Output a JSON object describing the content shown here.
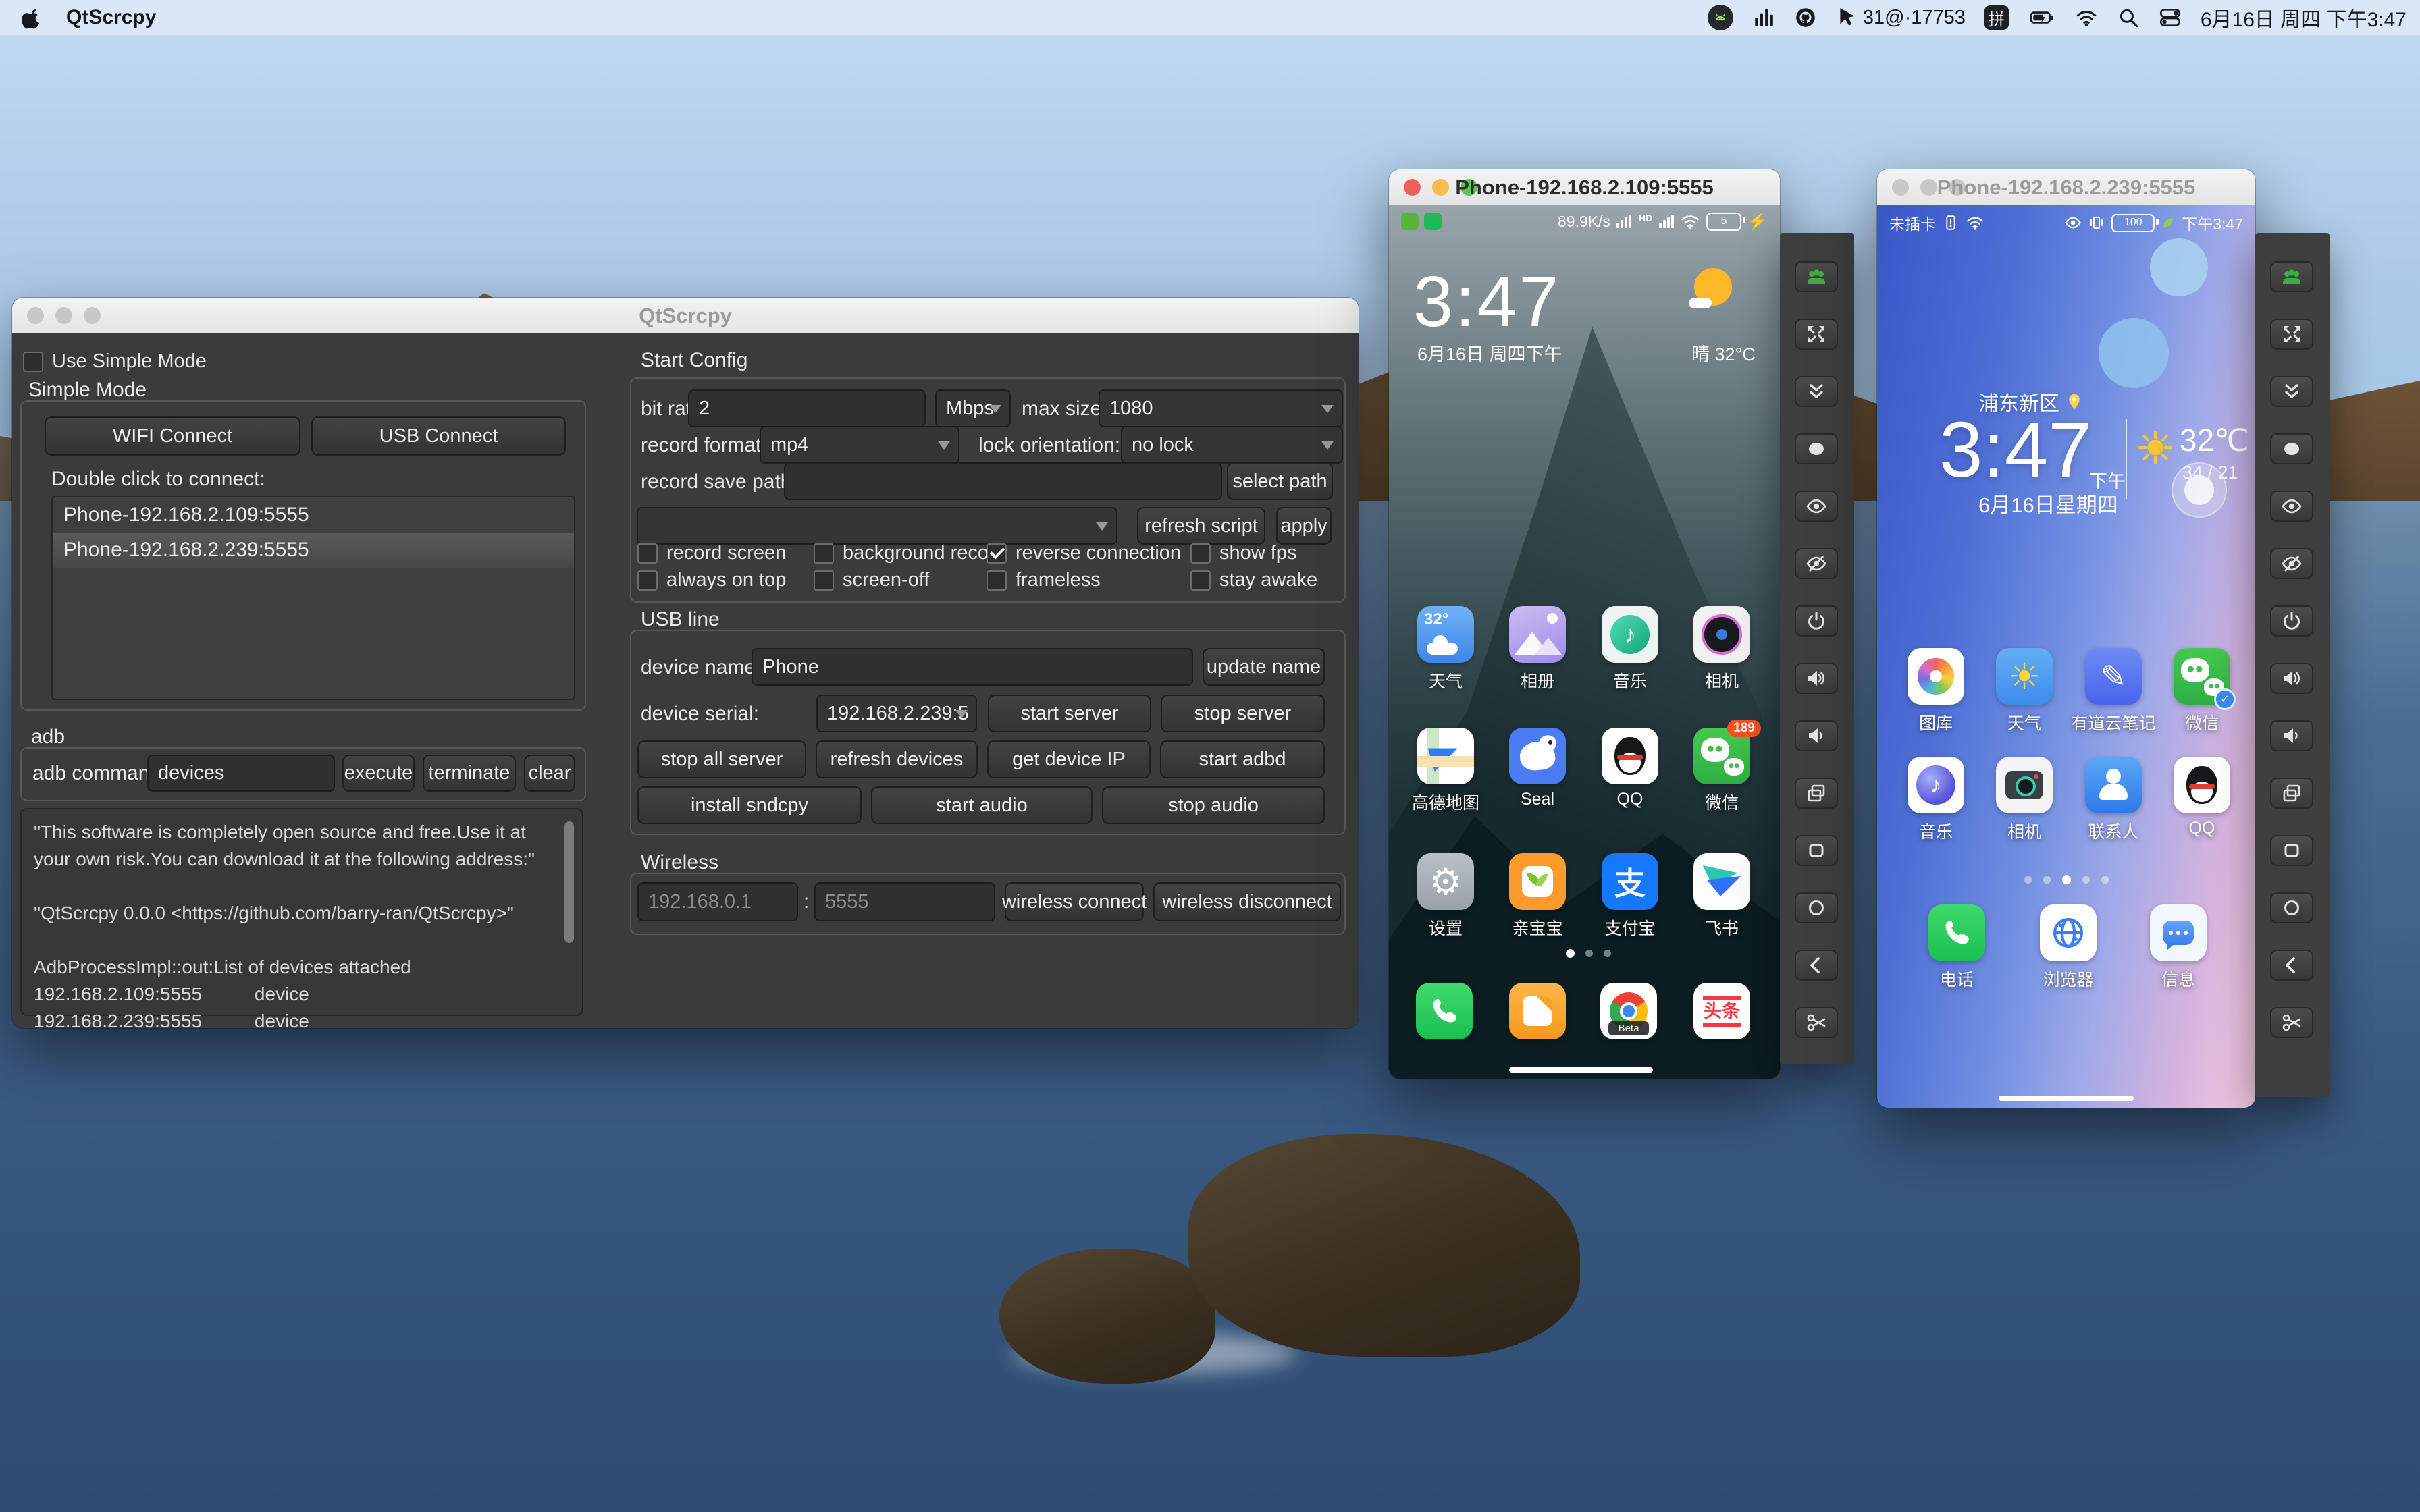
{
  "menubar": {
    "app_name": "QtScrcpy",
    "stat_text": "31@·17753",
    "ime": "拼",
    "datetime": "6月16日 周四 下午3:47"
  },
  "qtscrcpy": {
    "title": "QtScrcpy",
    "use_simple_mode": "Use Simple Mode",
    "simple_mode": "Simple Mode",
    "wifi_connect": "WIFI Connect",
    "usb_connect": "USB Connect",
    "double_click": "Double click to connect:",
    "devices": [
      {
        "name": "Phone-192.168.2.109:5555"
      },
      {
        "name": "Phone-192.168.2.239:5555"
      }
    ],
    "adb": {
      "label": "adb",
      "command_label": "adb command:",
      "command_value": "devices",
      "execute": "execute",
      "terminate": "terminate",
      "clear": "clear",
      "console": "\"This software is completely open source and free.Use it at your own risk.You can download it at the following address:\"\n\n\"QtScrcpy 0.0.0 <https://github.com/barry-ran/QtScrcpy>\"\n\nAdbProcessImpl::out:List of devices attached\n192.168.2.109:5555          device\n192.168.2.239:5555          device"
    },
    "start_config": {
      "title": "Start Config",
      "bit_rate_label": "bit rate:",
      "bit_rate_value": "2",
      "bit_rate_unit": "Mbps",
      "max_size_label": "max size:",
      "max_size_value": "1080",
      "record_format_label": "record format:",
      "record_format_value": "mp4",
      "lock_orientation_label": "lock orientation:",
      "lock_orientation_value": "no lock",
      "record_save_path_label": "record save path:",
      "record_save_path_value": "",
      "select_path": "select path",
      "script_value": "",
      "refresh_script": "refresh script",
      "apply": "apply",
      "record_screen": "record screen",
      "background_record": "background record",
      "reverse_connection": "reverse connection",
      "show_fps": "show fps",
      "always_on_top": "always on top",
      "screen_off": "screen-off",
      "frameless": "frameless",
      "stay_awake": "stay awake"
    },
    "usb_line": {
      "title": "USB line",
      "device_name_label": "device name:",
      "device_name_value": "Phone",
      "update_name": "update name",
      "device_serial_label": "device serial:",
      "device_serial_value": "192.168.2.239:5",
      "start_server": "start server",
      "stop_server": "stop server",
      "stop_all_server": "stop all server",
      "refresh_devices": "refresh devices",
      "get_device_ip": "get device IP",
      "start_adbd": "start adbd",
      "install_sndcpy": "install sndcpy",
      "start_audio": "start audio",
      "stop_audio": "stop audio"
    },
    "wireless": {
      "title": "Wireless",
      "ip_placeholder": "192.168.0.1",
      "sep": ":",
      "port_placeholder": "5555",
      "connect": "wireless connect",
      "disconnect": "wireless disconnect"
    }
  },
  "phone1": {
    "title": "Phone-192.168.2.109:5555",
    "status": {
      "speed": "89.9K/s",
      "hd": "HD",
      "battery": "5"
    },
    "clock": "3:47",
    "date": "6月16日 周四下午",
    "weather": "晴  32°C",
    "apps": [
      {
        "label": "天气",
        "deco": "32°"
      },
      {
        "label": "相册"
      },
      {
        "label": "音乐",
        "glyph": "♪"
      },
      {
        "label": "相机"
      },
      {
        "label": "高德地图"
      },
      {
        "label": "Seal"
      },
      {
        "label": "QQ"
      },
      {
        "label": "微信",
        "badge": "189"
      },
      {
        "label": "设置",
        "glyph": "⚙"
      },
      {
        "label": "亲宝宝"
      },
      {
        "label": "支付宝",
        "glyph": "支"
      },
      {
        "label": "飞书"
      }
    ],
    "dock": [
      {
        "name": "phone"
      },
      {
        "name": "gallery"
      },
      {
        "name": "chrome",
        "glyph": "Beta"
      },
      {
        "name": "toutiao",
        "glyph": "头条"
      }
    ]
  },
  "phone2": {
    "title": "Phone-192.168.2.239:5555",
    "status": {
      "sim": "未插卡",
      "battery": "100",
      "time": "下午3:47"
    },
    "location": "浦东新区",
    "clock": "3:47",
    "ampm": "下午",
    "temp": "32℃",
    "hilo": "34 / 21",
    "date": "6月16日星期四",
    "apps": [
      {
        "label": "图库"
      },
      {
        "label": "天气",
        "glyph": "☀"
      },
      {
        "label": "有道云笔记",
        "glyph": "✎"
      },
      {
        "label": "微信"
      },
      {
        "label": "音乐",
        "glyph": "♪"
      },
      {
        "label": "相机"
      },
      {
        "label": "联系人"
      },
      {
        "label": "QQ"
      }
    ],
    "dock": [
      {
        "label": "电话"
      },
      {
        "label": "浏览器"
      },
      {
        "label": "信息"
      }
    ]
  }
}
